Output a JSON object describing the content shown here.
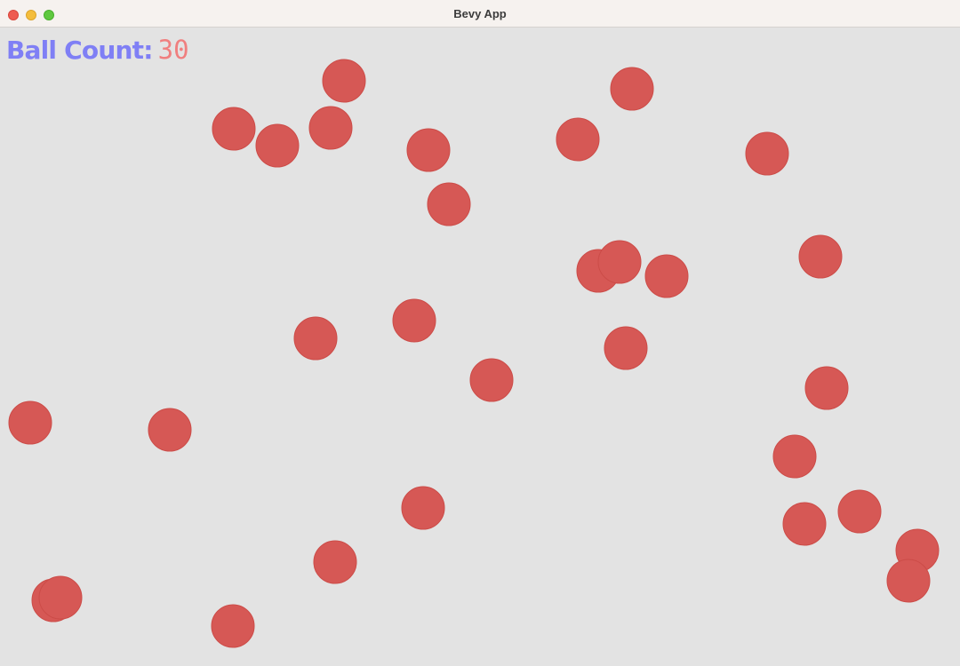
{
  "window": {
    "title": "Bevy App"
  },
  "hud": {
    "label": "Ball Count:",
    "count": "30",
    "label_color": "#7f7ff5",
    "value_color": "#f07f7f"
  },
  "balls": {
    "fill": "#d65855",
    "stroke": "#cc4c48",
    "count": 30
  }
}
